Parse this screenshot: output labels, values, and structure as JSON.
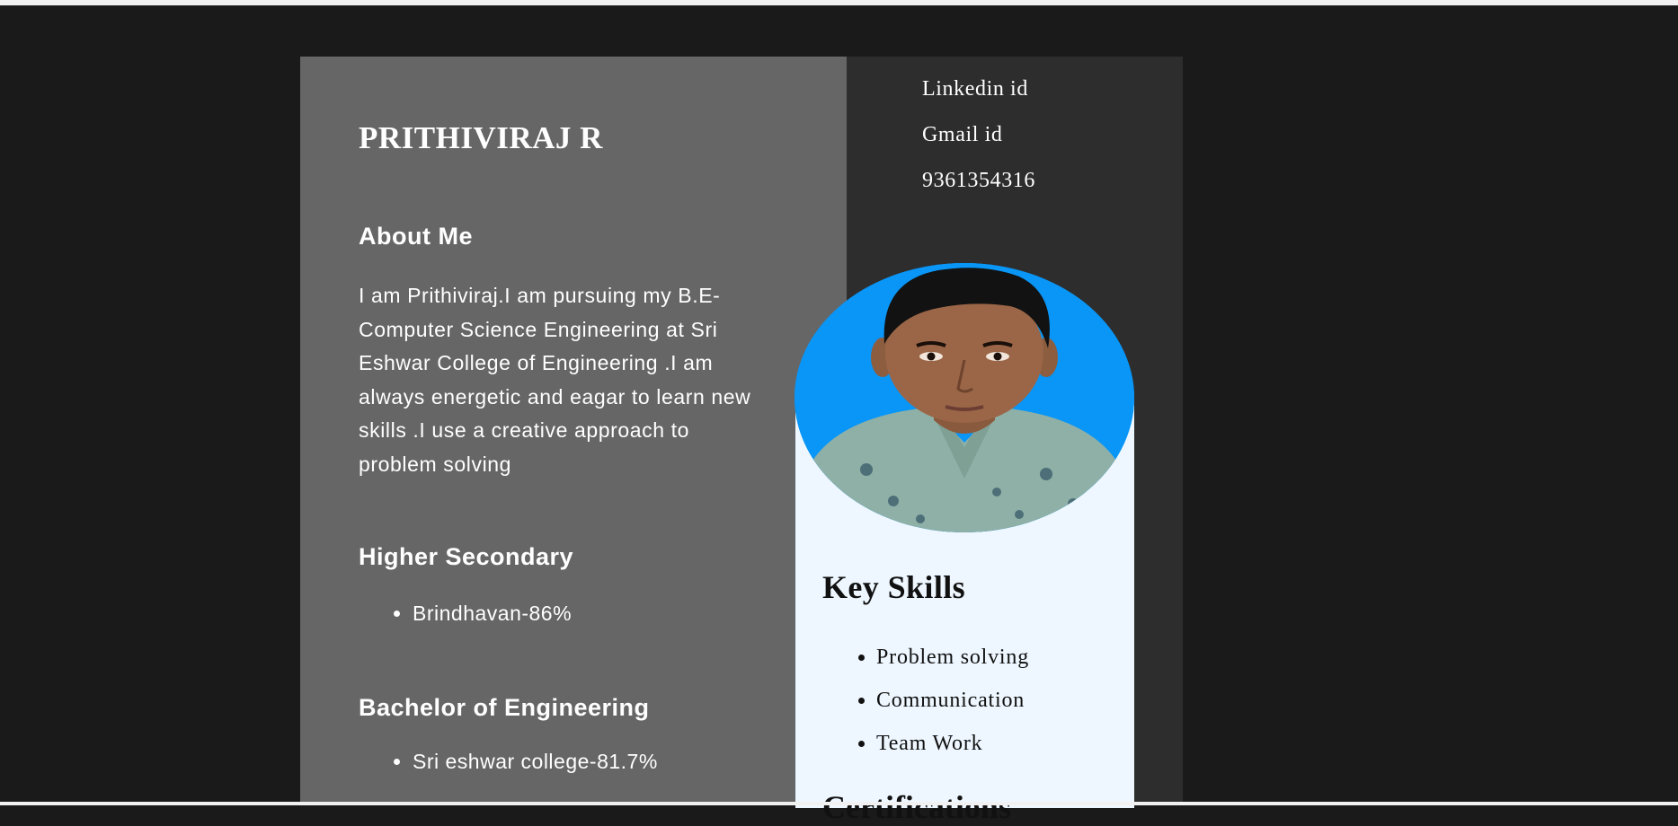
{
  "resume": {
    "name": "PRITHIVIRAJ R",
    "about": {
      "heading": "About Me",
      "text": "I am Prithiviraj.I am pursuing my B.E-Computer Science Engineering at Sri Eshwar College of Engineering .I am always energetic and eagar to learn new skills .I use a creative approach to problem solving"
    },
    "higher_secondary": {
      "heading": "Higher Secondary",
      "items": [
        "Brindhavan-86%"
      ]
    },
    "bachelor": {
      "heading": "Bachelor of Engineering",
      "items": [
        "Sri eshwar college-81.7%"
      ]
    }
  },
  "contact": {
    "linkedin": "Linkedin id",
    "gmail": "Gmail id",
    "phone": "9361354316"
  },
  "photo": {
    "alt": "profile photo",
    "background_color": "#0996f7"
  },
  "skills": {
    "heading": "Key Skills",
    "items": [
      "Problem solving",
      "Communication",
      "Team Work"
    ]
  },
  "certifications": {
    "heading": "Certifications"
  },
  "colors": {
    "page_background": "#1a1a1a",
    "left_panel": "#666666",
    "right_panel": "#2d2d2d",
    "skills_card": "#eef7ff"
  }
}
